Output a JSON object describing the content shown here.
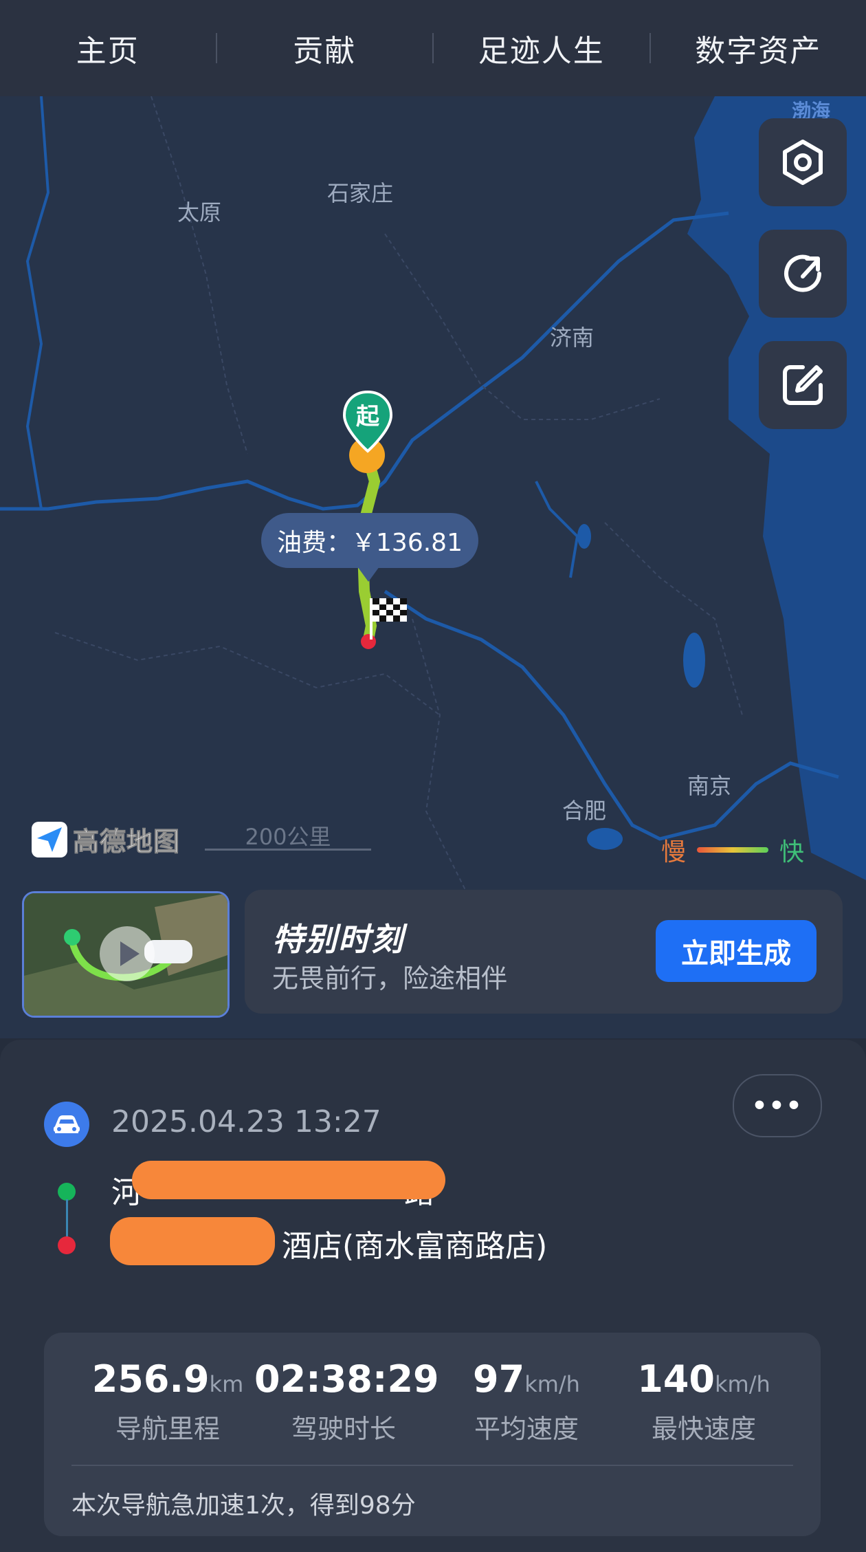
{
  "nav": {
    "tabs": [
      "主页",
      "贡献",
      "足迹人生",
      "数字资产"
    ]
  },
  "map": {
    "sea_label": "渤海",
    "cities": {
      "taiyuan": "太原",
      "shijiazhuang": "石家庄",
      "jinan": "济南",
      "hefei": "合肥",
      "nanjing": "南京"
    },
    "start_marker": "起",
    "fuel_cost": "油费：￥136.81",
    "logo_text": "高德地图",
    "scale_text": "200公里",
    "legend_slow": "慢",
    "legend_fast": "快",
    "buttons": [
      "settings-hex-icon",
      "share-icon",
      "edit-icon"
    ]
  },
  "promo": {
    "title": "特别时刻",
    "subtitle": "无畏前行，险途相伴",
    "button": "立即生成"
  },
  "trip": {
    "datetime": "2025.04.23 13:27",
    "more": "•••",
    "start_address": "河",
    "start_address_tail": "路",
    "end_address": "酒店(商水富商路店)",
    "stats": [
      {
        "value": "256.9",
        "unit": "km",
        "label": "导航里程"
      },
      {
        "value": "02:38:29",
        "unit": "",
        "label": "驾驶时长"
      },
      {
        "value": "97",
        "unit": "km/h",
        "label": "平均速度"
      },
      {
        "value": "140",
        "unit": "km/h",
        "label": "最快速度"
      }
    ],
    "note": "本次导航急加速1次，得到98分"
  },
  "colors": {
    "accent": "#1e6ff5",
    "start_dot": "#16b45a",
    "end_dot": "#e6283c",
    "route": "#9acd32"
  }
}
